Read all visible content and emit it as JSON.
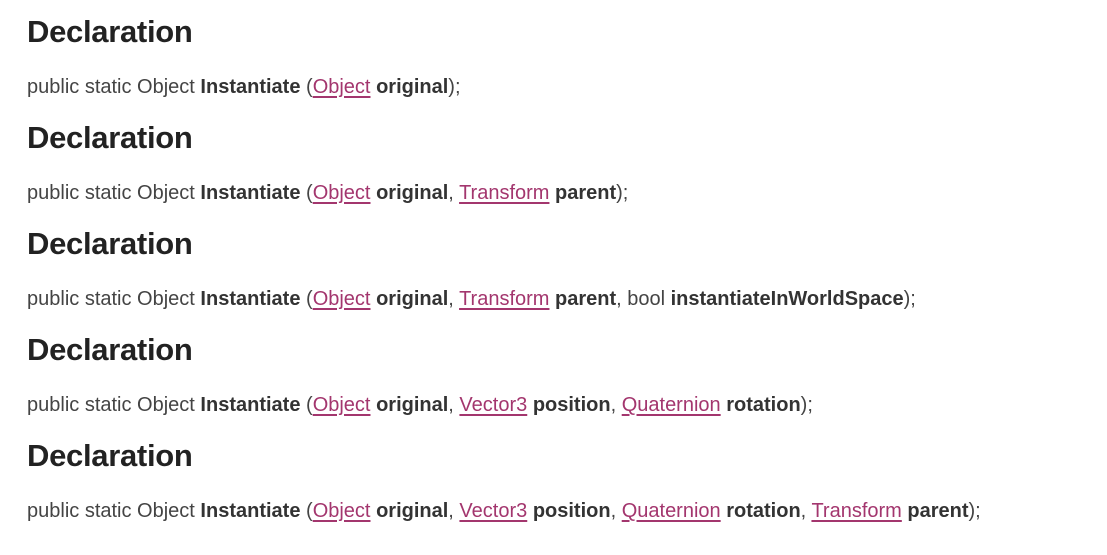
{
  "heading": "Declaration",
  "prefix": "public static Object ",
  "method": "Instantiate",
  "declarations": [
    {
      "parts": [
        {
          "t": "punct",
          "v": "("
        },
        {
          "t": "link",
          "v": "Object"
        },
        {
          "t": "punct",
          "v": " "
        },
        {
          "t": "param",
          "v": "original"
        },
        {
          "t": "punct",
          "v": ");"
        }
      ]
    },
    {
      "parts": [
        {
          "t": "punct",
          "v": "("
        },
        {
          "t": "link",
          "v": "Object"
        },
        {
          "t": "punct",
          "v": " "
        },
        {
          "t": "param",
          "v": "original"
        },
        {
          "t": "punct",
          "v": ", "
        },
        {
          "t": "link",
          "v": "Transform"
        },
        {
          "t": "punct",
          "v": " "
        },
        {
          "t": "param",
          "v": "parent"
        },
        {
          "t": "punct",
          "v": ");"
        }
      ]
    },
    {
      "parts": [
        {
          "t": "punct",
          "v": "("
        },
        {
          "t": "link",
          "v": "Object"
        },
        {
          "t": "punct",
          "v": " "
        },
        {
          "t": "param",
          "v": "original"
        },
        {
          "t": "punct",
          "v": ", "
        },
        {
          "t": "link",
          "v": "Transform"
        },
        {
          "t": "punct",
          "v": " "
        },
        {
          "t": "param",
          "v": "parent"
        },
        {
          "t": "punct",
          "v": ", bool "
        },
        {
          "t": "param",
          "v": "instantiateInWorldSpace"
        },
        {
          "t": "punct",
          "v": ");"
        }
      ]
    },
    {
      "parts": [
        {
          "t": "punct",
          "v": "("
        },
        {
          "t": "link",
          "v": "Object"
        },
        {
          "t": "punct",
          "v": " "
        },
        {
          "t": "param",
          "v": "original"
        },
        {
          "t": "punct",
          "v": ", "
        },
        {
          "t": "link",
          "v": "Vector3"
        },
        {
          "t": "punct",
          "v": " "
        },
        {
          "t": "param",
          "v": "position"
        },
        {
          "t": "punct",
          "v": ", "
        },
        {
          "t": "link",
          "v": "Quaternion"
        },
        {
          "t": "punct",
          "v": " "
        },
        {
          "t": "param",
          "v": "rotation"
        },
        {
          "t": "punct",
          "v": ");"
        }
      ]
    },
    {
      "parts": [
        {
          "t": "punct",
          "v": "("
        },
        {
          "t": "link",
          "v": "Object"
        },
        {
          "t": "punct",
          "v": " "
        },
        {
          "t": "param",
          "v": "original"
        },
        {
          "t": "punct",
          "v": ", "
        },
        {
          "t": "link",
          "v": "Vector3"
        },
        {
          "t": "punct",
          "v": " "
        },
        {
          "t": "param",
          "v": "position"
        },
        {
          "t": "punct",
          "v": ", "
        },
        {
          "t": "link",
          "v": "Quaternion"
        },
        {
          "t": "punct",
          "v": " "
        },
        {
          "t": "param",
          "v": "rotation"
        },
        {
          "t": "punct",
          "v": ", "
        },
        {
          "t": "link",
          "v": "Transform"
        },
        {
          "t": "punct",
          "v": " "
        },
        {
          "t": "param",
          "v": "parent"
        },
        {
          "t": "punct",
          "v": ");"
        }
      ]
    }
  ],
  "colors": {
    "heading": "#222222",
    "text": "#444444",
    "link": "#a3366e"
  }
}
